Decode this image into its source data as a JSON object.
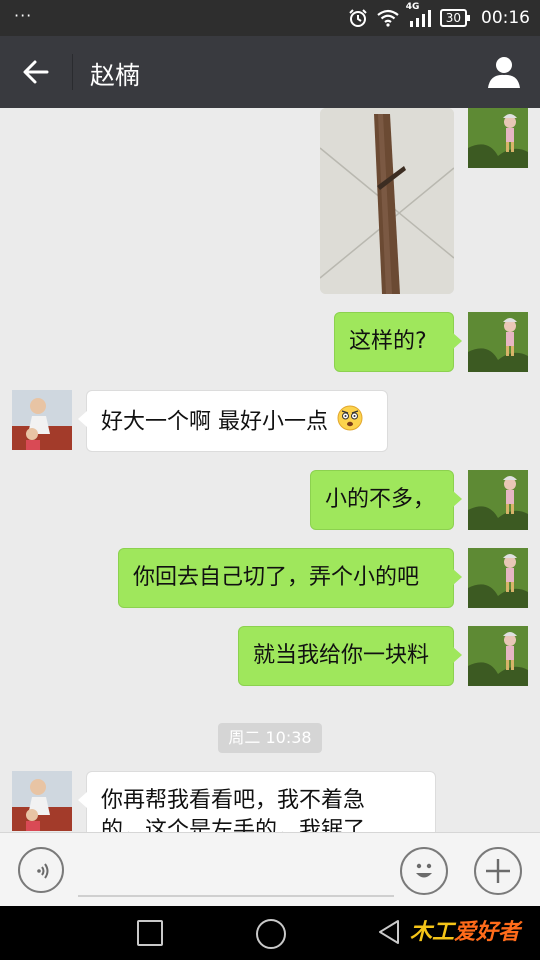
{
  "status_bar": {
    "dots": "···",
    "network": "4G",
    "battery": "30",
    "time": "00:16"
  },
  "header": {
    "title": "赵楠"
  },
  "messages": [
    {
      "side": "out",
      "type": "image"
    },
    {
      "side": "out",
      "type": "text",
      "text": "这样的?"
    },
    {
      "side": "in",
      "type": "text",
      "text": "好大一个啊 最好小一点",
      "emoji": "dizzy-face"
    },
    {
      "side": "out",
      "type": "text",
      "text": "小的不多，"
    },
    {
      "side": "out",
      "type": "text",
      "text": "你回去自己切了，弄个小的吧"
    },
    {
      "side": "out",
      "type": "text",
      "text": "就当我给你一块料"
    },
    {
      "side": "in",
      "type": "text",
      "lines": [
        "你再帮我看看吧，我不着急",
        "的，这个是左手的，我锯了"
      ]
    }
  ],
  "timestamp": "周二 10:38",
  "input_bar": {
    "icons": [
      "voice-icon",
      "emoji-icon",
      "plus-icon"
    ]
  },
  "nav_bar": {
    "icons": [
      "recent-apps-icon",
      "home-icon",
      "back-icon"
    ]
  },
  "watermark": {
    "mark": "木工",
    "text": "爱好者"
  },
  "colors": {
    "status_bar": "#2e2e2e",
    "title_bar": "#393a3f",
    "chat_bg": "#ebebeb",
    "bubble_out": "#9fe75c",
    "bubble_in": "#ffffff"
  }
}
